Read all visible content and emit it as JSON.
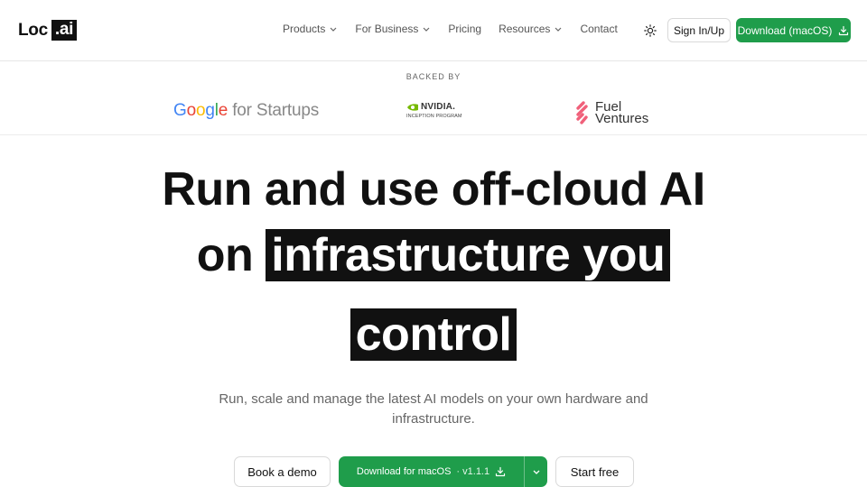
{
  "brand": {
    "prefix": "Loc",
    "suffix": ".ai"
  },
  "nav": {
    "items": [
      {
        "label": "Products",
        "has_dropdown": true
      },
      {
        "label": "For Business",
        "has_dropdown": true
      },
      {
        "label": "Pricing",
        "has_dropdown": false
      },
      {
        "label": "Resources",
        "has_dropdown": true
      },
      {
        "label": "Contact",
        "has_dropdown": false
      }
    ],
    "theme_icon": "sun-icon",
    "signin_label": "Sign In/Up",
    "download_label": "Download (macOS)"
  },
  "backed": {
    "label": "BACKED BY",
    "google": {
      "word": "Google",
      "rest": " for Startups"
    },
    "nvidia": {
      "name": "NVIDIA.",
      "sub": "INCEPTION PROGRAM"
    },
    "fuel": {
      "line1": "Fuel",
      "line2": "Ventures"
    }
  },
  "hero": {
    "line1": "Run and use off-cloud AI",
    "line2_plain": "on ",
    "line2_highlight": "infrastructure you",
    "line3_highlight": "control",
    "subtitle": "Run, scale and manage the latest AI models on your own hardware and infrastructure."
  },
  "cta": {
    "demo_label": "Book a demo",
    "download_label": "Download for macOS",
    "version": "· v1.1.1",
    "start_label": "Start free"
  },
  "colors": {
    "accent": "#1f9d4b",
    "text": "#111111",
    "muted": "#666666",
    "border": "#d9d9d9"
  }
}
